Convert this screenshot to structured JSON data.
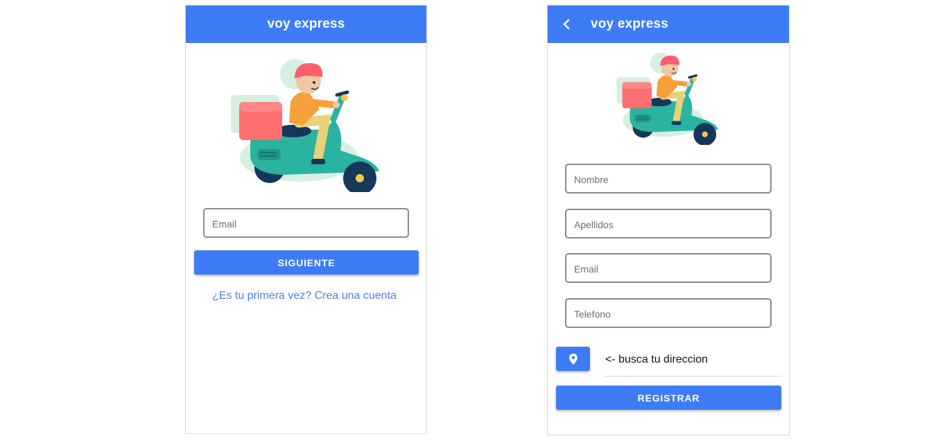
{
  "login": {
    "app_title": "voy express",
    "email_placeholder": "Email",
    "next_button": "SIGUIENTE",
    "signup_link": "¿Es tu primera vez? Crea una cuenta"
  },
  "register": {
    "app_title": "voy express",
    "back_icon": "chevron-left-icon",
    "fields": {
      "nombre_placeholder": "Nombre",
      "apellidos_placeholder": "Apellidos",
      "email_placeholder": "Email",
      "telefono_placeholder": "Telefono"
    },
    "location_icon": "map-pin-icon",
    "address_hint": "<- busca tu direccion",
    "register_button": "REGISTRAR"
  },
  "colors": {
    "primary": "#3d7cf6",
    "link": "#4a7fe8",
    "input_border": "#8a8a8a"
  }
}
